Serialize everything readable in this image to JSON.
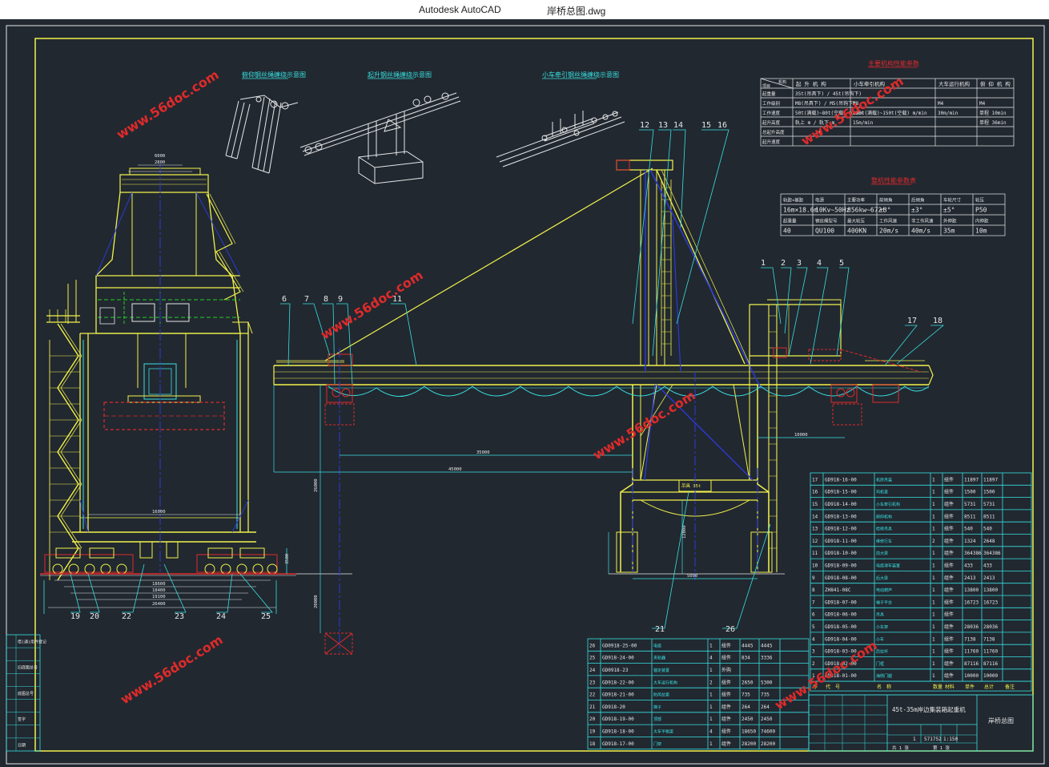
{
  "window": {
    "app_title": "Autodesk AutoCAD",
    "file_name": "岸桥总图.dwg"
  },
  "colors": {
    "background": "#212830",
    "frame": "#f2f24a",
    "cyan": "#38e0e0",
    "blue": "#2c3ad8",
    "red": "#e02a2a",
    "green": "#22d022",
    "white": "#e8e8e8",
    "watermark": "#e02a2a"
  },
  "watermark_text": "www.56doc.com",
  "view_titles": [
    "俯仰钢丝绳缠绕示意图",
    "起升钢丝绳缠绕示意图",
    "小车牵引钢丝绳缠绕示意图"
  ],
  "spec_table": {
    "title": "主要机构性能参数",
    "header_top": "机构",
    "header_left": "项目",
    "columns": [
      "起 升 机 构",
      "小车牵引机构",
      "大车运行机构",
      "俯 仰 机 构"
    ],
    "rows": [
      {
        "label": "起重量",
        "values": [
          "35t(吊具下) / 45t(吊钩下)",
          "",
          "",
          ""
        ]
      },
      {
        "label": "工作级别",
        "values": [
          "M8(吊具下) / M5(吊钩下)",
          "M8",
          "M4",
          "M4"
        ]
      },
      {
        "label": "工作速度",
        "values": [
          "50t(满载)~80t(空载) m/min",
          "100t(满载)~150t(空载) m/min",
          "30m/min",
          "单程 10min"
        ]
      },
      {
        "label": "起升高度",
        "values": [
          "轨上 m / 轨下 m",
          "15m/min",
          "",
          "单程 36min"
        ]
      },
      {
        "label": "总起升高度",
        "values": [
          "",
          "",
          "",
          ""
        ]
      },
      {
        "label": "起升速度",
        "values": [
          "",
          "",
          "",
          ""
        ]
      }
    ],
    "note_value": "2t"
  },
  "param_table": {
    "title": "整机性能参数表",
    "header_row_1": [
      "轨距×基距",
      "电源",
      "主要功率",
      "前倾角",
      "后倾角",
      "车轮尺寸",
      "轮压"
    ],
    "value_row_1": [
      "16m×18.6m",
      "10Kv~50Hz",
      "856kw~672t",
      "±3°",
      "±3°",
      "±5°",
      "P50"
    ],
    "header_row_2": [
      "起重量",
      "钢丝绳型号",
      "最大轮压",
      "工作风速",
      "非工作风速",
      "外伸距",
      "内伸距"
    ],
    "value_row_2": [
      "40",
      "QU100",
      "400KN",
      "20m/s",
      "40m/s",
      "35m",
      "10m"
    ]
  },
  "callouts": [
    "1",
    "2",
    "3",
    "4",
    "5",
    "6",
    "7",
    "8",
    "9",
    "11",
    "12",
    "13",
    "14",
    "15",
    "16",
    "17",
    "18",
    "19",
    "20",
    "21",
    "22",
    "23",
    "24",
    "25",
    "26"
  ],
  "dimensions": {
    "top_width": "6000",
    "top_inner": "2800",
    "rail_gauge": "16000",
    "outreach": "35000",
    "total_boom": "45000",
    "backreach": "10000",
    "base_1": "18600",
    "base_2": "18400",
    "base_3": "19100",
    "base_4": "26400",
    "lift_height": "26000",
    "below_rail": "20000",
    "portal_gap": "5000",
    "portal_clear": "12000",
    "bogie_h": "3500",
    "trolley_label": "吊具 35t"
  },
  "parts_right": [
    {
      "no": "17",
      "code": "GD918-16-00",
      "name": "机房吊装",
      "qty": "1",
      "mat": "组件",
      "unit": "11897",
      "total": "11897"
    },
    {
      "no": "16",
      "code": "GD918-15-00",
      "name": "司机室",
      "qty": "1",
      "mat": "组件",
      "unit": "1500",
      "total": "1500"
    },
    {
      "no": "15",
      "code": "GD918-14-00",
      "name": "小车牵引机构",
      "qty": "1",
      "mat": "组件",
      "unit": "5731",
      "total": "5731"
    },
    {
      "no": "14",
      "code": "GD918-13-00",
      "name": "俯仰机构",
      "qty": "1",
      "mat": "组件",
      "unit": "8511",
      "total": "8511"
    },
    {
      "no": "13",
      "code": "GD918-12-00",
      "name": "检修吊具",
      "qty": "1",
      "mat": "组件",
      "unit": "540",
      "total": "540"
    },
    {
      "no": "12",
      "code": "GD918-11-00",
      "name": "维修行车",
      "qty": "2",
      "mat": "组件",
      "unit": "1324",
      "total": "2648"
    },
    {
      "no": "11",
      "code": "GD918-10-00",
      "name": "前大梁",
      "qty": "1",
      "mat": "组件",
      "unit": "364386",
      "total": "364386"
    },
    {
      "no": "10",
      "code": "GD918-09-00",
      "name": "电缆滑车装置",
      "qty": "1",
      "mat": "组件",
      "unit": "433",
      "total": "433"
    },
    {
      "no": "9",
      "code": "GD918-08-00",
      "name": "后大梁",
      "qty": "1",
      "mat": "组件",
      "unit": "2413",
      "total": "2413"
    },
    {
      "no": "8",
      "code": "ZH841-08C",
      "name": "电动葫芦",
      "qty": "1",
      "mat": "组件",
      "unit": "13800",
      "total": "13800"
    },
    {
      "no": "7",
      "code": "GD918-07-00",
      "name": "梯子平台",
      "qty": "1",
      "mat": "组件",
      "unit": "16723",
      "total": "16723"
    },
    {
      "no": "6",
      "code": "GD918-06-00",
      "name": "吊具",
      "qty": "1",
      "mat": "组件",
      "unit": "",
      "total": ""
    },
    {
      "no": "5",
      "code": "GD918-05-00",
      "name": "小车架",
      "qty": "1",
      "mat": "组件",
      "unit": "28036",
      "total": "28036"
    },
    {
      "no": "4",
      "code": "GD918-04-00",
      "name": "小车",
      "qty": "1",
      "mat": "组件",
      "unit": "7138",
      "total": "7138"
    },
    {
      "no": "3",
      "code": "GD918-03-00",
      "name": "后拉杆",
      "qty": "1",
      "mat": "组件",
      "unit": "11760",
      "total": "11760"
    },
    {
      "no": "2",
      "code": "GD918-02-00",
      "name": "门框",
      "qty": "1",
      "mat": "组件",
      "unit": "87116",
      "total": "87116"
    },
    {
      "no": "1",
      "code": "GD918-01-00",
      "name": "海侧门腿",
      "qty": "1",
      "mat": "组件",
      "unit": "10000",
      "total": "10000"
    }
  ],
  "parts_right_header": [
    "序",
    "代　号",
    "名　称",
    "数量",
    "材料",
    "单件",
    "总计",
    "备注"
  ],
  "parts_left": [
    {
      "no": "26",
      "code": "GD0918-25-00",
      "name": "电缆",
      "qty": "1",
      "mat": "组件",
      "unit": "4445",
      "total": "4445"
    },
    {
      "no": "25",
      "code": "GD918-24-00",
      "name": "夹轨器",
      "qty": "4",
      "mat": "组件",
      "unit": "834",
      "total": "3336"
    },
    {
      "no": "24",
      "code": "GD0918-23",
      "name": "锚定装置",
      "qty": "1",
      "mat": "外购",
      "unit": "",
      "total": ""
    },
    {
      "no": "23",
      "code": "GD918-22-00",
      "name": "大车运行机构",
      "qty": "2",
      "mat": "组件",
      "unit": "2650",
      "total": "5300"
    },
    {
      "no": "22",
      "code": "GD918-21-00",
      "name": "防风拉索",
      "qty": "1",
      "mat": "组件",
      "unit": "735",
      "total": "735"
    },
    {
      "no": "21",
      "code": "GD918-20",
      "name": "梯子",
      "qty": "1",
      "mat": "组件",
      "unit": "264",
      "total": "264"
    },
    {
      "no": "20",
      "code": "GD918-19-00",
      "name": "顶部",
      "qty": "1",
      "mat": "组件",
      "unit": "2450",
      "total": "2450"
    },
    {
      "no": "19",
      "code": "GD918-18-00",
      "name": "大车平衡梁",
      "qty": "4",
      "mat": "组件",
      "unit": "18650",
      "total": "74600"
    },
    {
      "no": "18",
      "code": "GD918-17-00",
      "name": "门架",
      "qty": "1",
      "mat": "组件",
      "unit": "28200",
      "total": "28200"
    }
  ],
  "title_block": {
    "product": "45t-35m岸边集装箱起重机",
    "drawing_name": "岸桥总图",
    "weight": "571752",
    "scale": "1:150",
    "qty": "1",
    "sheet": "共 1 张",
    "sheet_no": "第 1 张"
  },
  "side_block": [
    "借(通)用件登记",
    "",
    "旧底图总号",
    "",
    "底图总号",
    "",
    "签字",
    "",
    "日期"
  ]
}
